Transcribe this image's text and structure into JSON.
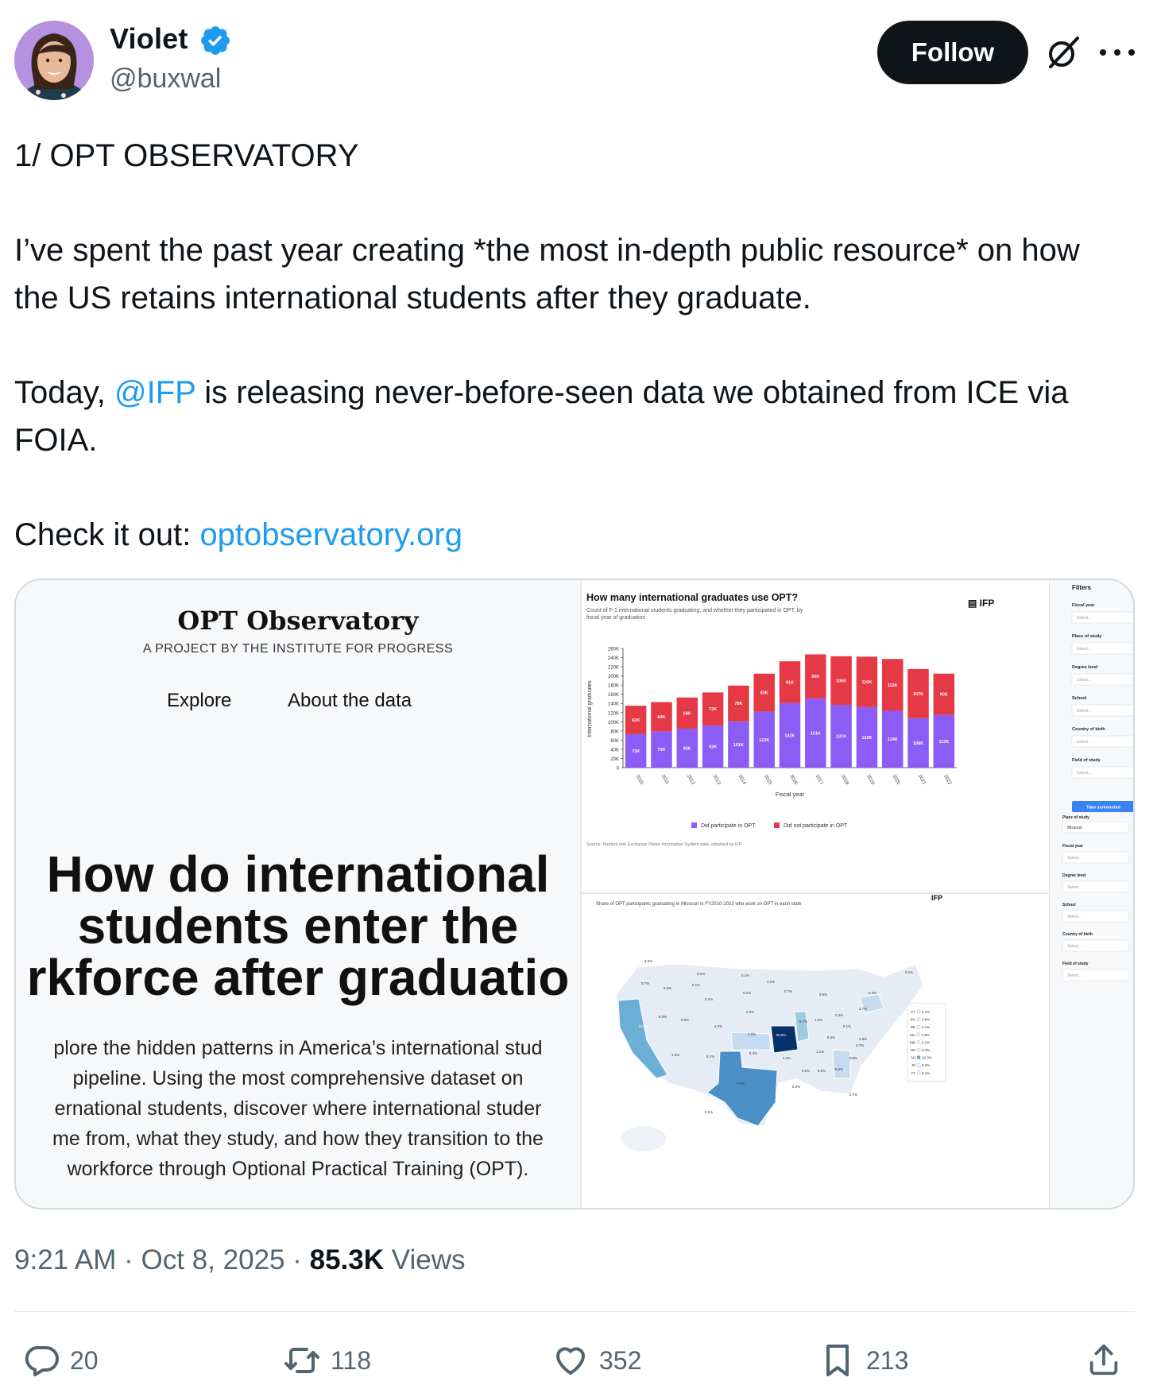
{
  "author": {
    "name": "Violet",
    "handle": "@buxwal"
  },
  "header": {
    "follow_label": "Follow"
  },
  "tweet": {
    "line1": "1/ OPT OBSERVATORY",
    "para2": "I’ve spent the past year creating *the most in-depth public resource* on how the US retains international students after they graduate.",
    "para3_pre": "Today, ",
    "para3_mention": "@IFP",
    "para3_post": " is releasing never-before-seen data we obtained from ICE via FOIA.",
    "para4_pre": "Check it out: ",
    "para4_link": "optobservatory.org"
  },
  "card": {
    "site_title": "OPT Observatory",
    "site_subtitle": "A PROJECT BY THE INSTITUTE FOR PROGRESS",
    "nav": [
      "Explore",
      "About the data"
    ],
    "hero_lines": [
      "How do international",
      "students enter the",
      "rkforce after graduatio"
    ],
    "body_lines": [
      "plore the hidden patterns in America’s international stud",
      "pipeline. Using the most comprehensive dataset on",
      "ernational students, discover where international studer",
      "me from, what they study, and how they transition to the",
      "workforce through Optional Practical Training (OPT)."
    ]
  },
  "chart_data": {
    "type": "bar",
    "title": "How many international graduates use OPT?",
    "subtitle": "Count of F-1 international students graduating, and whether they participated in OPT, by fiscal year of graduation",
    "brand": "IFP",
    "xlabel": "Fiscal year",
    "ylabel": "International graduates",
    "ylim": [
      0,
      260000
    ],
    "yticks": [
      "0",
      "20K",
      "40K",
      "60K",
      "80K",
      "100K",
      "120K",
      "140K",
      "160K",
      "180K",
      "200K",
      "220K",
      "240K",
      "260K"
    ],
    "categories": [
      "2010",
      "2011",
      "2012",
      "2013",
      "2014",
      "2015",
      "2016",
      "2017",
      "2018",
      "2019",
      "2020",
      "2021",
      "2022"
    ],
    "series": [
      {
        "name": "Did participate in OPT",
        "color": "#8b5cf6",
        "values": [
          73000,
          79000,
          85000,
          92000,
          101000,
          122000,
          141000,
          151000,
          137000,
          132000,
          124000,
          108000,
          115000
        ],
        "labels": [
          "73K",
          "79K",
          "85K",
          "92K",
          "101K",
          "122K",
          "141K",
          "151K",
          "137K",
          "132K",
          "124K",
          "108K",
          "115K"
        ]
      },
      {
        "name": "Did not participate in OPT",
        "color": "#e63946",
        "values": [
          62000,
          64000,
          68000,
          72000,
          78000,
          83000,
          91000,
          96000,
          106000,
          110000,
          113000,
          107000,
          90000
        ],
        "labels": [
          "62K",
          "64K",
          "68K",
          "72K",
          "78K",
          "83K",
          "91K",
          "96K",
          "106K",
          "110K",
          "113K",
          "107K",
          "90K"
        ]
      }
    ],
    "legend": "bottom",
    "source": "Source: Student and Exchange Visitor Information System data, obtained by IFP"
  },
  "map": {
    "title": "Share of OPT participants graduating in Missouri in FY2010-2022 who work on OPT in each state",
    "brand": "IFP",
    "labels": [
      "3.3%",
      "0.7%",
      "0.2%",
      "0.1%",
      "0.1%",
      "1.1%",
      "0.1%",
      "0.7%",
      "3.6%",
      "6.4%",
      "0.1%",
      "0.1%",
      "0.1%",
      "2.0%",
      "0.3%",
      "0.5%",
      "13.3%",
      "1.3%",
      "4.2%",
      "28.8%",
      "6.7%",
      "1.0%",
      "2.3%",
      "2.7%",
      "0.5%",
      "0.1%",
      "4.8%",
      "3.7%",
      "1.3%",
      "0.1%",
      "0.4%",
      "1.3%",
      "1.1%",
      "0.8%",
      "0.2%",
      "0.3%",
      "5.5%",
      "0.0%",
      "0.3%",
      "2.7%",
      "0.1%"
    ],
    "legend_states": [
      "CT",
      "DC",
      "DE",
      "MA",
      "MD",
      "NH",
      "NJ",
      "RI",
      "VT"
    ],
    "legend_values": [
      "1.1%",
      "0.8%",
      "1.1%",
      "3.8%",
      "2.2%",
      "0.3%",
      "10.3%",
      "0.2%",
      "0.1%"
    ]
  },
  "filters": {
    "title": "Filters",
    "items": [
      "Fiscal year",
      "Place of study",
      "Degree level",
      "School",
      "Country of birth",
      "Field of study"
    ],
    "placeholder": "Select...",
    "screenshot_button": "Take screenshot",
    "lower_header": "Place of study",
    "lower_value": "Missouri",
    "lower_items": [
      "Fiscal year",
      "Degree level",
      "School",
      "Country of birth",
      "Field of study"
    ]
  },
  "timestamp": {
    "time": "9:21 AM",
    "date": "Oct 8, 2025",
    "views_count": "85.3K",
    "views_label": "Views"
  },
  "actions": {
    "replies": "20",
    "reposts": "118",
    "likes": "352",
    "bookmarks": "213"
  },
  "colors": {
    "accent": "#1d9bf0",
    "text": "#0f1419",
    "muted": "#536471",
    "opt_yes": "#8b5cf6",
    "opt_no": "#e63946",
    "missouri": "#08306b"
  }
}
